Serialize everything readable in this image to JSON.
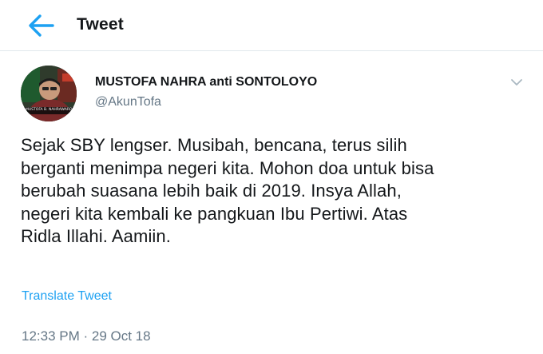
{
  "header": {
    "title": "Tweet"
  },
  "author": {
    "display_name": "MUSTOFA NAHRA anti SONTOLOYO",
    "handle": "@AkunTofa",
    "avatar_caption": "MUSTOFA B. NAHRAWARDAYA"
  },
  "tweet": {
    "text": "Sejak SBY lengser. Musibah, bencana, terus silih\nberganti menimpa negeri kita. Mohon doa untuk bisa\nberubah suasana lebih baik di 2019. Insya Allah,\nnegeri kita kembali ke pangkuan Ibu Pertiwi. Atas\nRidla Illahi. Aamiin.",
    "translate_label": "Translate Tweet",
    "timestamp": "12:33 PM · 29 Oct 18"
  },
  "colors": {
    "accent": "#1da1f2",
    "text_primary": "#14171a",
    "text_secondary": "#657786",
    "divider": "#e1e8ed"
  },
  "icons": {
    "back": "arrow-left-icon",
    "more": "chevron-down-icon"
  }
}
